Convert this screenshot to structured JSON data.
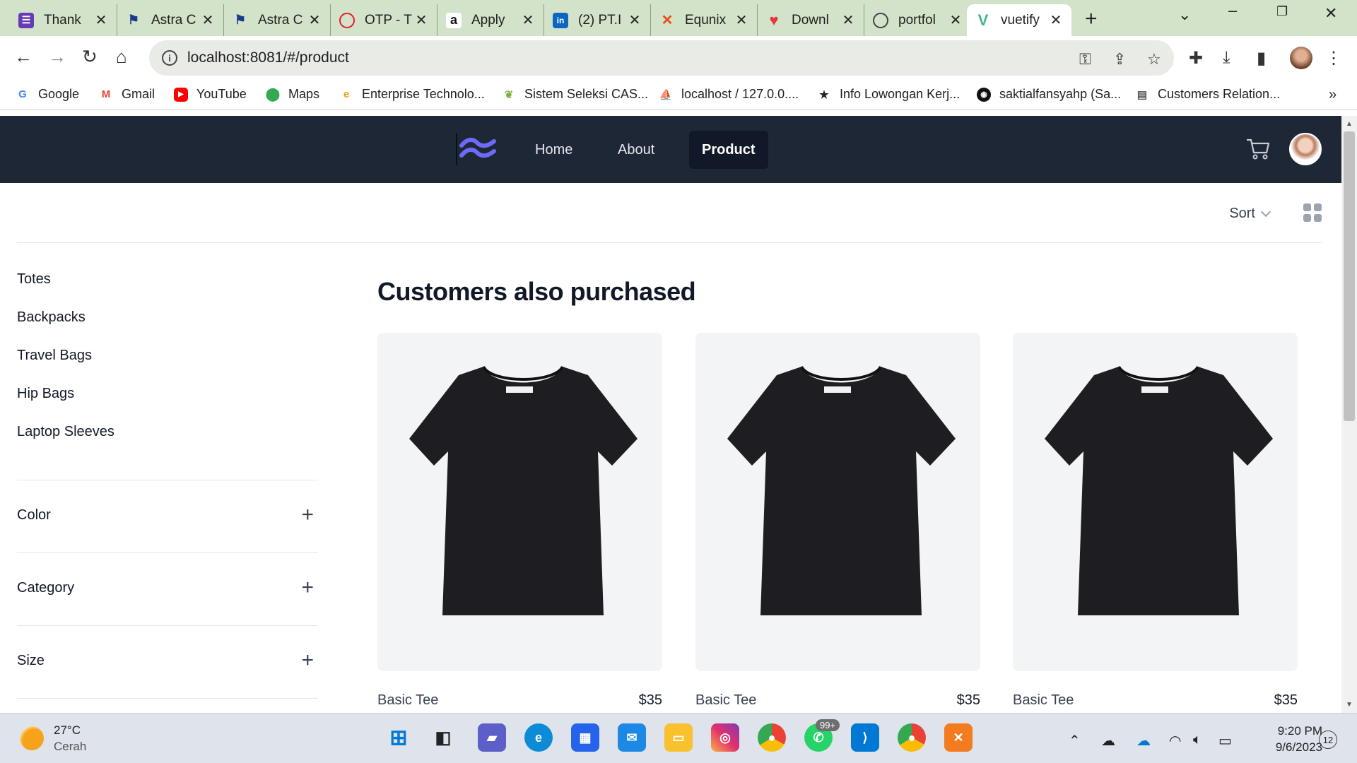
{
  "browser": {
    "tabs": [
      {
        "title": "Thank",
        "icon": "forms-icon",
        "color": "#673ab7"
      },
      {
        "title": "Astra C",
        "icon": "flag-icon",
        "color": "#1a3a8c"
      },
      {
        "title": "Astra C",
        "icon": "flag-icon",
        "color": "#1a3a8c"
      },
      {
        "title": "OTP - T",
        "icon": "toyota-icon",
        "color": "#e41e2b"
      },
      {
        "title": "Apply",
        "icon": "amazon-icon",
        "color": "#111111"
      },
      {
        "title": "(2) PT.I",
        "icon": "linkedin-icon",
        "color": "#0a66c2"
      },
      {
        "title": "Equnix",
        "icon": "equnix-icon",
        "color": "#e64a19"
      },
      {
        "title": "Downl",
        "icon": "heart-icon",
        "color": "#e53935"
      },
      {
        "title": "portfol",
        "icon": "globe-icon",
        "color": "#555555"
      },
      {
        "title": "vuetify",
        "icon": "vue-icon",
        "color": "#41b883"
      }
    ],
    "url": "localhost:8081/#/product",
    "bookmarks": [
      {
        "label": "Google",
        "icon": "google-icon"
      },
      {
        "label": "Gmail",
        "icon": "gmail-icon"
      },
      {
        "label": "YouTube",
        "icon": "youtube-icon"
      },
      {
        "label": "Maps",
        "icon": "maps-icon"
      },
      {
        "label": "Enterprise Technolo...",
        "icon": "enterprise-icon"
      },
      {
        "label": "Sistem Seleksi CAS...",
        "icon": "leaf-icon"
      },
      {
        "label": "localhost / 127.0.0....",
        "icon": "pma-icon"
      },
      {
        "label": "Info Lowongan Kerj...",
        "icon": "star-icon"
      },
      {
        "label": "saktialfansyahp (Sa...",
        "icon": "github-icon"
      },
      {
        "label": "Customers Relation...",
        "icon": "crm-icon"
      }
    ]
  },
  "app": {
    "nav": {
      "home": "Home",
      "about": "About",
      "product": "Product"
    },
    "sort_label": "Sort",
    "categories": [
      "Totes",
      "Backpacks",
      "Travel Bags",
      "Hip Bags",
      "Laptop Sleeves"
    ],
    "filters": [
      "Color",
      "Category",
      "Size"
    ],
    "heading": "Customers also purchased",
    "products": [
      {
        "name": "Basic Tee",
        "price": "$35"
      },
      {
        "name": "Basic Tee",
        "price": "$35"
      },
      {
        "name": "Basic Tee",
        "price": "$35"
      }
    ],
    "accent": "#1e2736"
  },
  "taskbar": {
    "temp": "27°C",
    "weather": "Cerah",
    "whatsapp_badge": "99+",
    "time": "9:20 PM",
    "date": "9/6/2023",
    "notifications": "12"
  }
}
